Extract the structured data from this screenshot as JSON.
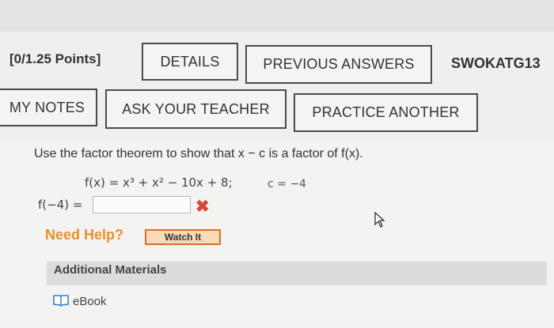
{
  "header": {
    "points": "[0/1.25 Points]",
    "details_label": "DETAILS",
    "previous_answers_label": "PREVIOUS ANSWERS",
    "assignment_code": "SWOKATG13"
  },
  "actions": {
    "my_notes_label": "MY NOTES",
    "ask_teacher_label": "ASK YOUR TEACHER",
    "practice_another_label": "PRACTICE ANOTHER"
  },
  "question": {
    "instruction": "Use the factor theorem to show that x − c is a factor of f(x).",
    "function": "f(x) = x³ + x² − 10x + 8;",
    "c_value": "c = −4",
    "answer_label": "f(−4) =",
    "answer_value": "",
    "answer_status": "✖"
  },
  "help": {
    "need_help_label": "Need Help?",
    "watch_label": "Watch It"
  },
  "materials": {
    "title": "Additional Materials",
    "ebook_label": "eBook"
  },
  "icons": {
    "incorrect": "x-mark-icon",
    "ebook": "book-icon",
    "cursor": "mouse-pointer-icon"
  },
  "colors": {
    "need_help": "#e88f2f",
    "watch_border": "#d96f2a",
    "watch_fill": "#f9d9b6",
    "incorrect": "#d6483c",
    "ebook_icon": "#3a7fc2"
  }
}
